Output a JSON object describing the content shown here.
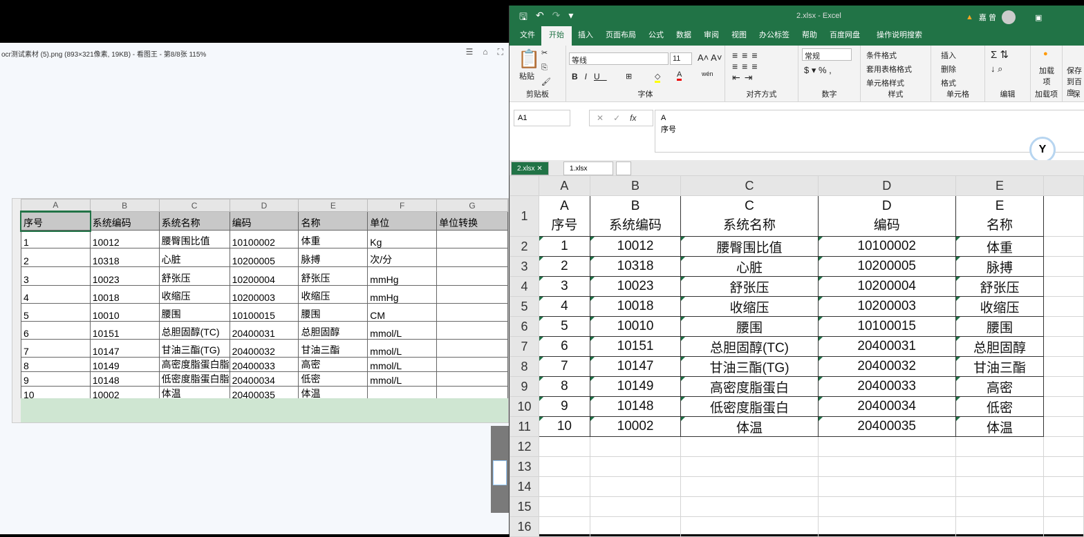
{
  "viewer": {
    "title": "ocr测试素材 (5).png  (893×321像素, 19KB) - 看图王 - 第8/8张 115%",
    "icons": [
      "menu-icon",
      "shirt-icon",
      "fullscreen-icon"
    ],
    "icon_glyphs": [
      "☰",
      "⌂",
      "⛶"
    ]
  },
  "image_table": {
    "col_headers": [
      "A",
      "B",
      "C",
      "D",
      "E",
      "F",
      "G"
    ],
    "rows": [
      [
        "序号",
        "系统编码",
        "系统名称",
        "编码",
        "名称",
        "单位",
        "单位转换"
      ],
      [
        "1",
        "10012",
        "腰臀围比值",
        "10100002",
        "体重",
        "Kg",
        ""
      ],
      [
        "2",
        "10318",
        "心脏",
        "10200005",
        "脉搏",
        "次/分",
        ""
      ],
      [
        "3",
        "10023",
        "舒张压",
        "10200004",
        "舒张压",
        "mmHg",
        ""
      ],
      [
        "4",
        "10018",
        "收缩压",
        "10200003",
        "收缩压",
        "mmHg",
        ""
      ],
      [
        "5",
        "10010",
        "腰围",
        "10100015",
        "腰围",
        "CM",
        ""
      ],
      [
        "6",
        "10151",
        "总胆固醇(TC)",
        "20400031",
        "总胆固醇",
        "mmol/L",
        ""
      ],
      [
        "7",
        "10147",
        "甘油三酯(TG)",
        "20400032",
        "甘油三酯",
        "mmol/L",
        ""
      ],
      [
        "8",
        "10149",
        "高密度脂蛋白脂",
        "20400033",
        "高密",
        "mmol/L",
        ""
      ],
      [
        "9",
        "10148",
        "低密度脂蛋白脂",
        "20400034",
        "低密",
        "mmol/L",
        ""
      ],
      [
        "10",
        "10002",
        "体温",
        "20400035",
        "体温",
        "",
        ""
      ]
    ]
  },
  "excel": {
    "title": "2.xlsx  -  Excel",
    "user": "嘉 曾",
    "menu": [
      "文件",
      "开始",
      "插入",
      "页面布局",
      "公式",
      "数据",
      "审阅",
      "视图",
      "办公标签",
      "帮助",
      "百度网盘",
      "操作说明搜索"
    ],
    "ribbon": {
      "paste": "粘贴",
      "clipboard": "剪贴板",
      "font_name": "等线",
      "font_size": "11",
      "font": "字体",
      "align": "对齐方式",
      "number_format": "常规",
      "number": "数字",
      "cond_format": "条件格式",
      "table_format": "套用表格格式",
      "cell_style": "单元格样式",
      "styles": "样式",
      "insert": "插入",
      "delete": "删除",
      "format": "格式",
      "cells": "单元格",
      "edit": "编辑",
      "addin": "加载项",
      "addin_btn": "加载项",
      "save_baidu": "保存到百度",
      "save_group": "保"
    },
    "name_box": "A1",
    "formula_lines": [
      "A",
      "序号"
    ],
    "tabs": [
      "2.xlsx",
      "1.xlsx"
    ],
    "col_headers": [
      "A",
      "B",
      "C",
      "D",
      "E",
      ""
    ],
    "row1": [
      "A\n序号",
      "B\n系统编码",
      "C\n系统名称",
      "D\n编码",
      "E\n名称",
      ""
    ],
    "rows": [
      [
        "1",
        "10012",
        "腰臀围比值",
        "10100002",
        "体重"
      ],
      [
        "2",
        "10318",
        "心脏",
        "10200005",
        "脉搏"
      ],
      [
        "3",
        "10023",
        "舒张压",
        "10200004",
        "舒张压"
      ],
      [
        "4",
        "10018",
        "收缩压",
        "10200003",
        "收缩压"
      ],
      [
        "5",
        "10010",
        "腰围",
        "10100015",
        "腰围"
      ],
      [
        "6",
        "10151",
        "总胆固醇(TC)",
        "20400031",
        "总胆固醇"
      ],
      [
        "7",
        "10147",
        "甘油三酯(TG)",
        "20400032",
        "甘油三酯"
      ],
      [
        "8",
        "10149",
        "高密度脂蛋白",
        "20400033",
        "高密"
      ],
      [
        "9",
        "10148",
        "低密度脂蛋白",
        "20400034",
        "低密"
      ],
      [
        "10",
        "10002",
        "体温",
        "20400035",
        "体温"
      ]
    ],
    "row_numbers": [
      "1",
      "2",
      "3",
      "4",
      "5",
      "6",
      "7",
      "8",
      "9",
      "10",
      "11",
      "12",
      "13",
      "14",
      "15",
      "16"
    ],
    "accent": "#217346"
  }
}
